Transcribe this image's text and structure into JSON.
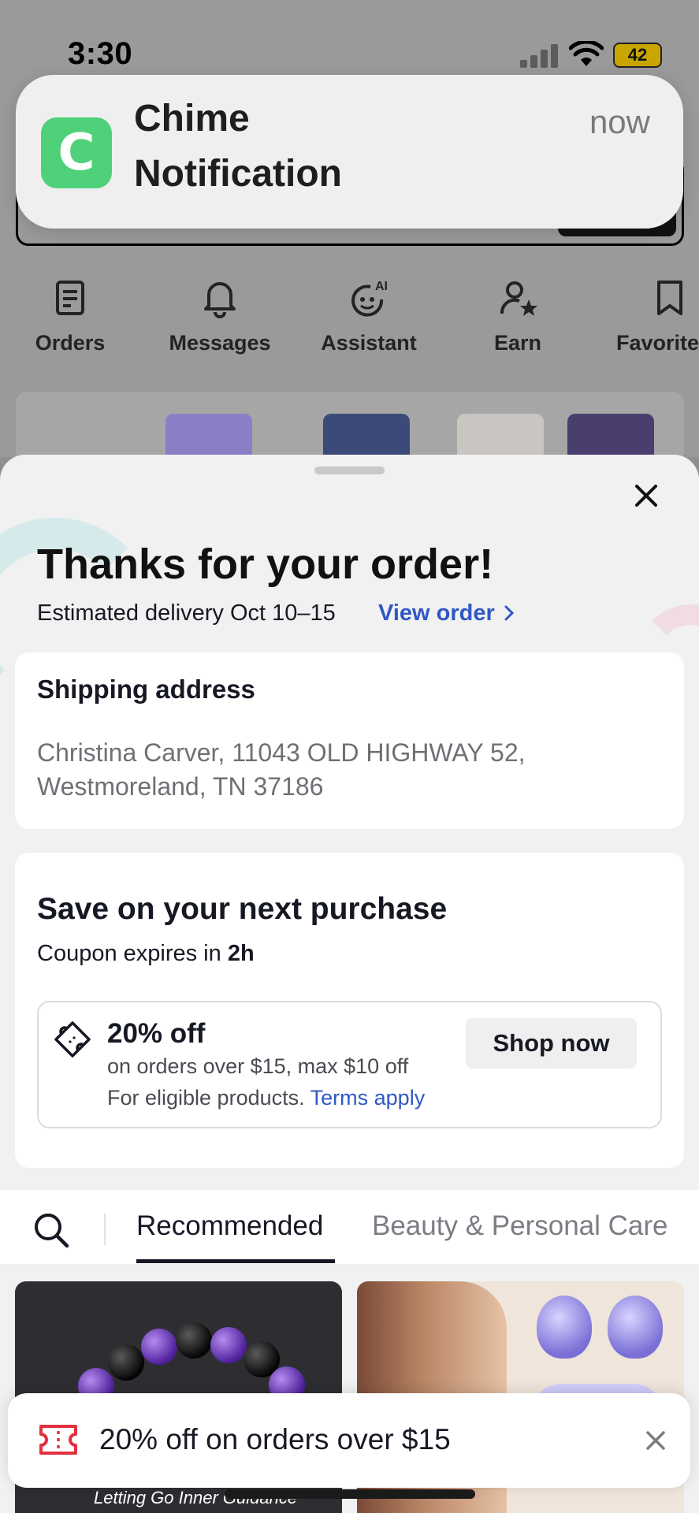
{
  "status_bar": {
    "time": "3:30",
    "battery": "42"
  },
  "notification": {
    "app": "Chime",
    "body": "Notification",
    "time": "now"
  },
  "quick_nav": [
    {
      "label": "Orders",
      "icon": "orders-icon"
    },
    {
      "label": "Messages",
      "icon": "bell-icon"
    },
    {
      "label": "Assistant",
      "icon": "ai-assistant-icon"
    },
    {
      "label": "Earn",
      "icon": "person-star-icon"
    },
    {
      "label": "Favorite",
      "icon": "bookmark-icon"
    }
  ],
  "sheet": {
    "title": "Thanks for your order!",
    "delivery": "Estimated delivery Oct 10–15",
    "view_order": "View order",
    "shipping": {
      "title": "Shipping address",
      "address": "Christina Carver, 11043 OLD HIGHWAY 52, Westmoreland, TN 37186"
    },
    "save": {
      "title": "Save on your next purchase",
      "expires_prefix": "Coupon expires in",
      "expires_value": "2h",
      "coupon": {
        "title": "20% off",
        "line1": "on orders over $15, max $10 off",
        "line2_prefix": "For eligible products.",
        "terms": "Terms apply",
        "cta": "Shop now"
      }
    },
    "tabs": {
      "active": "Recommended",
      "inactive": "Beauty & Personal Care"
    },
    "products": {
      "left_caption": "Letting Go Inner Guidance"
    }
  },
  "toast": {
    "text": "20% off on orders over $15"
  },
  "colors": {
    "link": "#2f58c4",
    "chime_green": "#4fd17a",
    "coupon_red": "#e3303f"
  }
}
